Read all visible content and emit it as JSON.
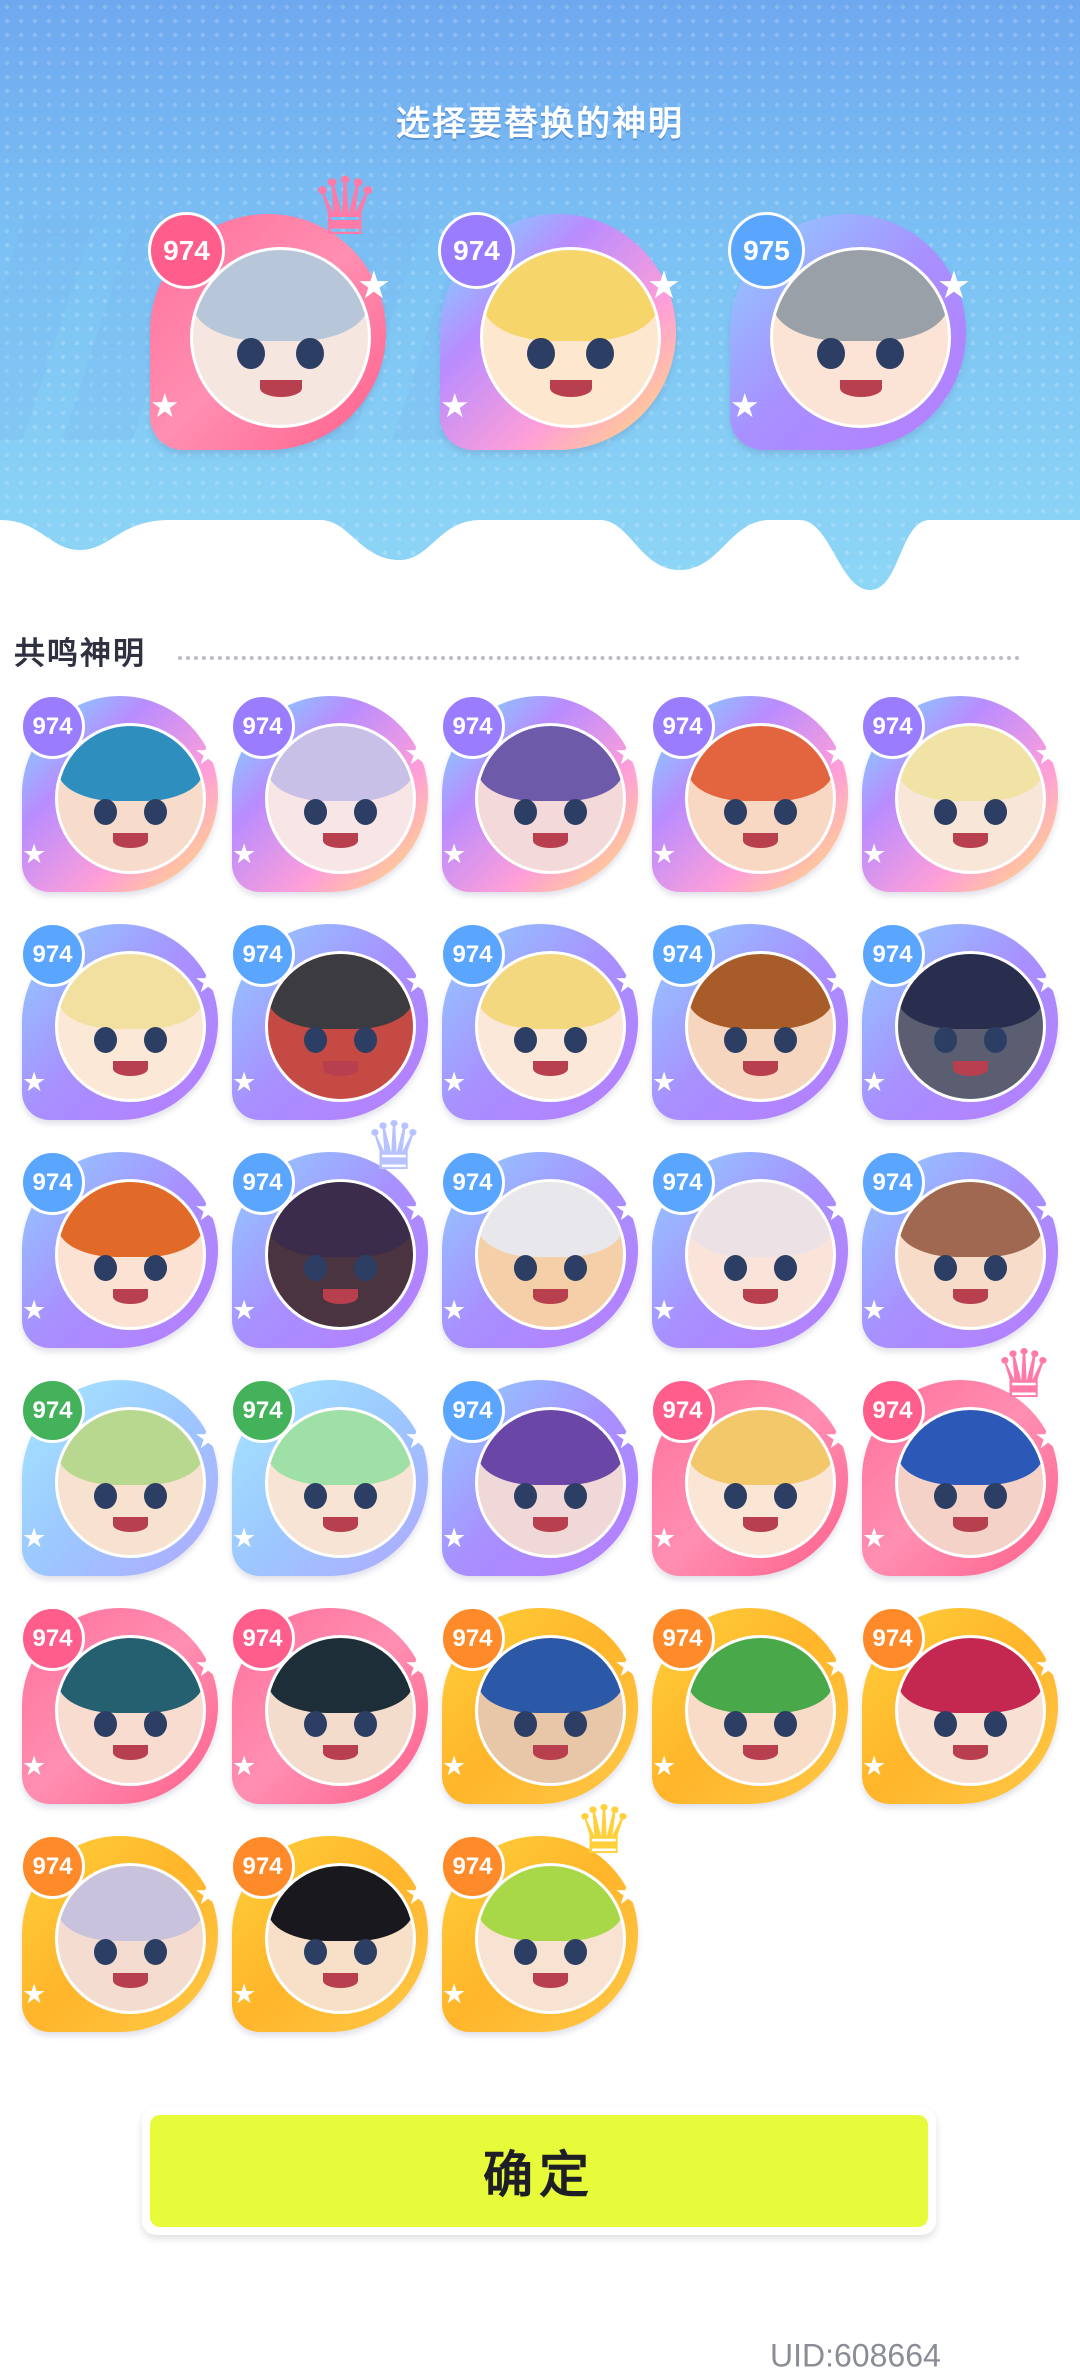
{
  "header": {
    "title": "选择要替换的神明"
  },
  "selected": [
    {
      "level": "974",
      "frame": "pink",
      "hair": "#b8c6da",
      "skin": "#f6e6e0",
      "crown": true
    },
    {
      "level": "974",
      "frame": "rainbow",
      "hair": "#f6d56a",
      "skin": "#fde8cf",
      "crown": false
    },
    {
      "level": "975",
      "frame": "purple",
      "hair": "#9aa0a8",
      "skin": "#fbe4d6",
      "crown": false
    }
  ],
  "section": {
    "label": "共鸣神明"
  },
  "grid": [
    {
      "level": "974",
      "frame": "rainbow",
      "hair": "#2e8fbf",
      "skin": "#f7dccc",
      "crown": false
    },
    {
      "level": "974",
      "frame": "rainbow",
      "hair": "#c9c0e8",
      "skin": "#f8e6e6",
      "crown": false
    },
    {
      "level": "974",
      "frame": "rainbow",
      "hair": "#6d5aa8",
      "skin": "#f3d9d9",
      "crown": false
    },
    {
      "level": "974",
      "frame": "rainbow",
      "hair": "#e2653f",
      "skin": "#f8d8c2",
      "crown": false
    },
    {
      "level": "974",
      "frame": "rainbow",
      "hair": "#f1e2a6",
      "skin": "#f8e6d8",
      "crown": false
    },
    {
      "level": "974",
      "frame": "purple",
      "hair": "#f1e0a0",
      "skin": "#fbe8d6",
      "crown": false
    },
    {
      "level": "974",
      "frame": "purple",
      "hair": "#3c3c40",
      "skin": "#c64a44",
      "crown": false
    },
    {
      "level": "974",
      "frame": "purple",
      "hair": "#f4d880",
      "skin": "#fbe8d8",
      "crown": false
    },
    {
      "level": "974",
      "frame": "purple",
      "hair": "#a85c2a",
      "skin": "#f6d6bf",
      "crown": false
    },
    {
      "level": "974",
      "frame": "purple",
      "hair": "#2a2e4e",
      "skin": "#5a5e70",
      "crown": false
    },
    {
      "level": "974",
      "frame": "purple",
      "hair": "#e26a28",
      "skin": "#fbe2d2",
      "crown": false
    },
    {
      "level": "974",
      "frame": "purple",
      "hair": "#3a2c4a",
      "skin": "#4a3440",
      "crown": true
    },
    {
      "level": "974",
      "frame": "purple",
      "hair": "#e8e8ec",
      "skin": "#f4cfa8",
      "crown": false
    },
    {
      "level": "974",
      "frame": "purple",
      "hair": "#ece2e6",
      "skin": "#fae4da",
      "crown": false
    },
    {
      "level": "974",
      "frame": "purple",
      "hair": "#a06850",
      "skin": "#f8dcca",
      "crown": false
    },
    {
      "level": "974",
      "frame": "cyan",
      "hair": "#b8d890",
      "skin": "#f6e2cf",
      "crown": false
    },
    {
      "level": "974",
      "frame": "cyan",
      "hair": "#9ee0a6",
      "skin": "#f8e4d4",
      "crown": false
    },
    {
      "level": "974",
      "frame": "purple",
      "hair": "#6a46a6",
      "skin": "#f0d8d8",
      "crown": false
    },
    {
      "level": "974",
      "frame": "pink",
      "hair": "#f2c86a",
      "skin": "#fbe6d6",
      "crown": false
    },
    {
      "level": "974",
      "frame": "pink",
      "hair": "#2c58b8",
      "skin": "#f4d2c8",
      "crown": true
    },
    {
      "level": "974",
      "frame": "pink",
      "hair": "#246070",
      "skin": "#f8dcd0",
      "crown": false
    },
    {
      "level": "974",
      "frame": "pink",
      "hair": "#1e2e38",
      "skin": "#f4dccc",
      "crown": false
    },
    {
      "level": "974",
      "frame": "gold",
      "hair": "#2c58a8",
      "skin": "#e8c6a8",
      "crown": false
    },
    {
      "level": "974",
      "frame": "gold",
      "hair": "#48a84a",
      "skin": "#f8dcc8",
      "crown": false
    },
    {
      "level": "974",
      "frame": "gold",
      "hair": "#c42850",
      "skin": "#f8e0d4",
      "crown": false
    },
    {
      "level": "974",
      "frame": "gold",
      "hair": "#c8c2dc",
      "skin": "#f4dcd0",
      "crown": false
    },
    {
      "level": "974",
      "frame": "gold",
      "hair": "#18181e",
      "skin": "#f8e0c8",
      "crown": false
    },
    {
      "level": "974",
      "frame": "gold",
      "hair": "#a8d848",
      "skin": "#f8e2d2",
      "crown": true
    }
  ],
  "frames": {
    "pink": {
      "ring": "linear-gradient(135deg,#ff6f9a,#ff8fb2,#ff5f8a)",
      "badge": "#ff5d8c",
      "crown": "#ff7aa7"
    },
    "rainbow": {
      "ring": "linear-gradient(135deg,#6fe6ff,#b98cff,#ff9fd8,#ffe36f)",
      "badge": "#9a7cff",
      "crown": "#b69cff"
    },
    "purple": {
      "ring": "linear-gradient(135deg,#8fd0ff,#a890ff,#b77cff)",
      "badge": "#5aa6ff",
      "crown": "#b7c2ff"
    },
    "cyan": {
      "ring": "linear-gradient(135deg,#a6e7ff,#9cc8ff,#b0a8ff)",
      "badge": "#44b25a",
      "crown": "#b7c2ff"
    },
    "gold": {
      "ring": "linear-gradient(135deg,#ffd03a,#ffb52a,#ffc949)",
      "badge": "#ff8a2a",
      "crown": "#ffd03a"
    }
  },
  "actions": {
    "confirm_label": "确定"
  },
  "footer": {
    "uid": "UID:608664"
  }
}
